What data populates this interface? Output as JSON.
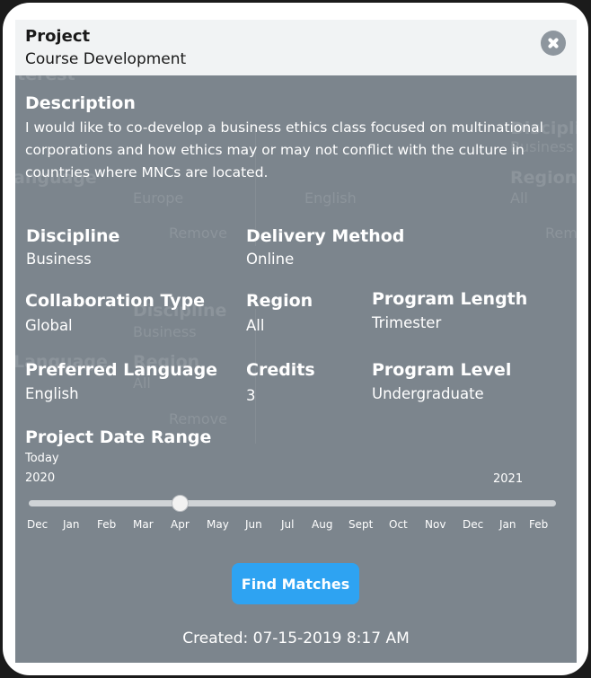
{
  "header": {
    "title": "Project",
    "subtitle": "Course Development"
  },
  "background_ghost": {
    "texts": [
      "terest",
      "Discipli",
      "Business",
      "anguage",
      "Region",
      "Europe",
      "English",
      "All",
      "Remove",
      "Remo",
      "Discipline",
      "Business",
      "Language",
      "Region",
      "All",
      "Remove"
    ]
  },
  "description": {
    "heading": "Description",
    "text": "I would like to co-develop a business ethics class focused on multinational corporations and how ethics may or may not conflict with the culture in countries where MNCs are located."
  },
  "fields": {
    "discipline": {
      "label": "Discipline",
      "value": "Business"
    },
    "delivery_method": {
      "label": "Delivery Method",
      "value": "Online"
    },
    "collaboration_type": {
      "label": "Collaboration Type",
      "value": "Global"
    },
    "region": {
      "label": "Region",
      "value": "All"
    },
    "program_length": {
      "label": "Program Length",
      "value": "Trimester"
    },
    "preferred_language": {
      "label": "Preferred Language",
      "value": "English"
    },
    "credits": {
      "label": "Credits",
      "value": "3"
    },
    "program_level": {
      "label": "Program Level",
      "value": "Undergraduate"
    }
  },
  "date_range": {
    "label": "Project Date Range",
    "today_label": "Today",
    "year_start": "2020",
    "year_end": "2021",
    "months": [
      "Dec",
      "Jan",
      "Feb",
      "Mar",
      "Apr",
      "May",
      "Jun",
      "Jul",
      "Aug",
      "Sept",
      "Oct",
      "Nov",
      "Dec",
      "Jan",
      "Feb"
    ],
    "selected_month_index": 4
  },
  "actions": {
    "find_matches": "Find Matches"
  },
  "created": "Created: 07-15-2019 8:17 AM",
  "colors": {
    "overlay": "#7c858d",
    "accent": "#2ea3f2",
    "header_bg": "#f1f3f4"
  }
}
